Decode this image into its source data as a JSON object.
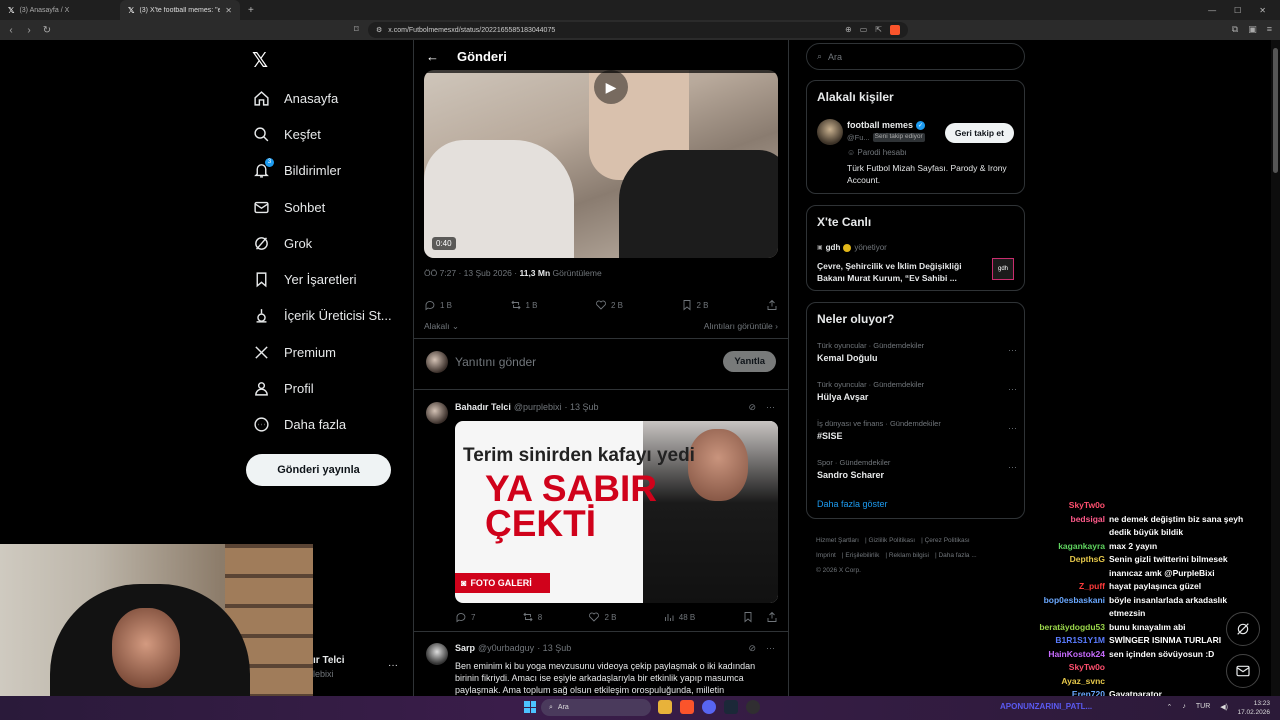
{
  "browser": {
    "tabs": [
      {
        "title": "(3) Anasayfa / X"
      },
      {
        "title": "(3) X'te football memes: \"eş değ..."
      }
    ],
    "url": "x.com/Futbolmemesxd/status/2022165585183044075"
  },
  "nav": {
    "items": [
      {
        "label": "Anasayfa",
        "icon": "home-icon"
      },
      {
        "label": "Keşfet",
        "icon": "search-icon"
      },
      {
        "label": "Bildirimler",
        "icon": "bell-icon",
        "badge": "3"
      },
      {
        "label": "Sohbet",
        "icon": "mail-icon"
      },
      {
        "label": "Grok",
        "icon": "grok-icon"
      },
      {
        "label": "Yer İşaretleri",
        "icon": "bookmark-icon"
      },
      {
        "label": "İçerik Üreticisi St...",
        "icon": "creator-icon"
      },
      {
        "label": "Premium",
        "icon": "x-icon"
      },
      {
        "label": "Profil",
        "icon": "person-icon"
      },
      {
        "label": "Daha fazla",
        "icon": "more-icon"
      }
    ],
    "post_button": "Gönderi yayınla"
  },
  "main": {
    "header_title": "Gönderi",
    "video_duration": "0:40",
    "meta_time": "ÖÖ 7:27 · 13 Şub 2026 · ",
    "meta_views": "11,3 Mn",
    "meta_views_label": " Görüntüleme",
    "actions": {
      "replies": "1 B",
      "reposts": "1 B",
      "likes": "2 B",
      "bookmarks": "2 B"
    },
    "related_label": "Alakalı",
    "quotes_label": "Alıntıları görüntüle",
    "reply_placeholder": "Yanıtını gönder",
    "reply_button": "Yanıtla",
    "tweets": [
      {
        "name": "Bahadır Telci",
        "handle": "@purplebixi",
        "date": "· 13 Şub",
        "image_headline": "Terim sinirden kafayı yedi",
        "image_title_line1": "YA SABIR",
        "image_title_line2": "ÇEKTİ",
        "image_badge": "FOTO GALERİ",
        "actions": {
          "replies": "7",
          "reposts": "8",
          "likes": "2 B",
          "views": "48 B"
        }
      },
      {
        "name": "Sarp",
        "handle": "@y0urbadguy",
        "date": "· 13 Şub",
        "text": "Ben eminim ki bu yoga mevzusunu videoya çekip paylaşmak o iki kadından birinin fikriydi. Amacı ise eşiyle arkadaşlarıyla bir etkinlik yapıp masumca paylaşmak. Ama toplum sağ olsun etkileşim orospuluğunda, milletin"
      }
    ]
  },
  "sidebar": {
    "search_placeholder": "Ara",
    "related": {
      "title": "Alakalı kişiler",
      "name": "football memes",
      "handle": "@Fu...",
      "follows_you": "Seni takip ediyor",
      "follow_button": "Geri takip et",
      "parody": "Parodi hesabı",
      "bio": "Türk Futbol Mizah Sayfası. Parody & Irony Account."
    },
    "live": {
      "title": "X'te Canlı",
      "host": "gdh",
      "role": "yönetiyor",
      "space_title": "Çevre, Şehircilik ve İklim Değişikliği Bakanı Murat Kurum, “Ev Sahibi ...",
      "thumb": "gdh"
    },
    "trends": {
      "title": "Neler oluyor?",
      "items": [
        {
          "category": "Türk oyuncular · Gündemdekiler",
          "name": "Kemal Doğulu"
        },
        {
          "category": "Türk oyuncular · Gündemdekiler",
          "name": "Hülya Avşar"
        },
        {
          "category": "İş dünyası ve finans · Gündemdekiler",
          "name": "#SISE"
        },
        {
          "category": "Spor · Gündemdekiler",
          "name": "Sandro Scharer"
        }
      ],
      "show_more": "Daha fazla göster"
    },
    "footer": [
      "Hizmet Şartları",
      "Gizlilik Politikası",
      "Çerez Politikası",
      "Imprint",
      "Erişilebilirlik",
      "Reklam bilgisi",
      "Daha fazla ...",
      "© 2026 X Corp."
    ]
  },
  "webcam_overlay": {
    "name": "ır Telci",
    "handle": "lebixi"
  },
  "chat": [
    {
      "user": "SkyTw0o",
      "color": "#ff4f6e",
      "msg": ""
    },
    {
      "user": "bedsigal",
      "color": "#ff5a8a",
      "msg": "ne demek değiştim biz sana şeyh dedik büyük bildik"
    },
    {
      "user": "kagankayra",
      "color": "#5fd35f",
      "msg": "max 2 yayın"
    },
    {
      "user": "DepthsG",
      "color": "#e6c84a",
      "msg": "Senin gizli twitterini bilmesek inanıcaz amk @PurpleBixi"
    },
    {
      "user": "Z_puff",
      "color": "#ff3b3b",
      "msg": "hayat paylaşınca güzel"
    },
    {
      "user": "bop0esbaskani",
      "color": "#6aa8ff",
      "msg": "böyle insanlarlada arkadaslık etmezsin"
    },
    {
      "user": "beratäydogdu53",
      "color": "#9ad64a",
      "msg": "bunu kınayalım abi"
    },
    {
      "user": "B1R1S1Y1M",
      "color": "#5a7cff",
      "msg": "SWİNGER ISINMA TURLARI"
    },
    {
      "user": "HainKostok24",
      "color": "#c86cff",
      "msg": "sen içinden sövüyosun :D"
    },
    {
      "user": "SkyTw0o",
      "color": "#ff4f6e",
      "msg": ""
    },
    {
      "user": "Ayaz_svnc",
      "color": "#e6c84a",
      "msg": ""
    },
    {
      "user": "Eren720",
      "color": "#6aa8ff",
      "msg": "Gavatparator"
    }
  ],
  "taskbar": {
    "search": "Ara",
    "stream_label": "APONUNZARINI_PATL...",
    "lang": "TUR",
    "time": "13:23",
    "date": "17.02.2026"
  },
  "colors": {
    "accent": "#1d9bf0",
    "background": "#000000",
    "border": "#2f3336"
  }
}
